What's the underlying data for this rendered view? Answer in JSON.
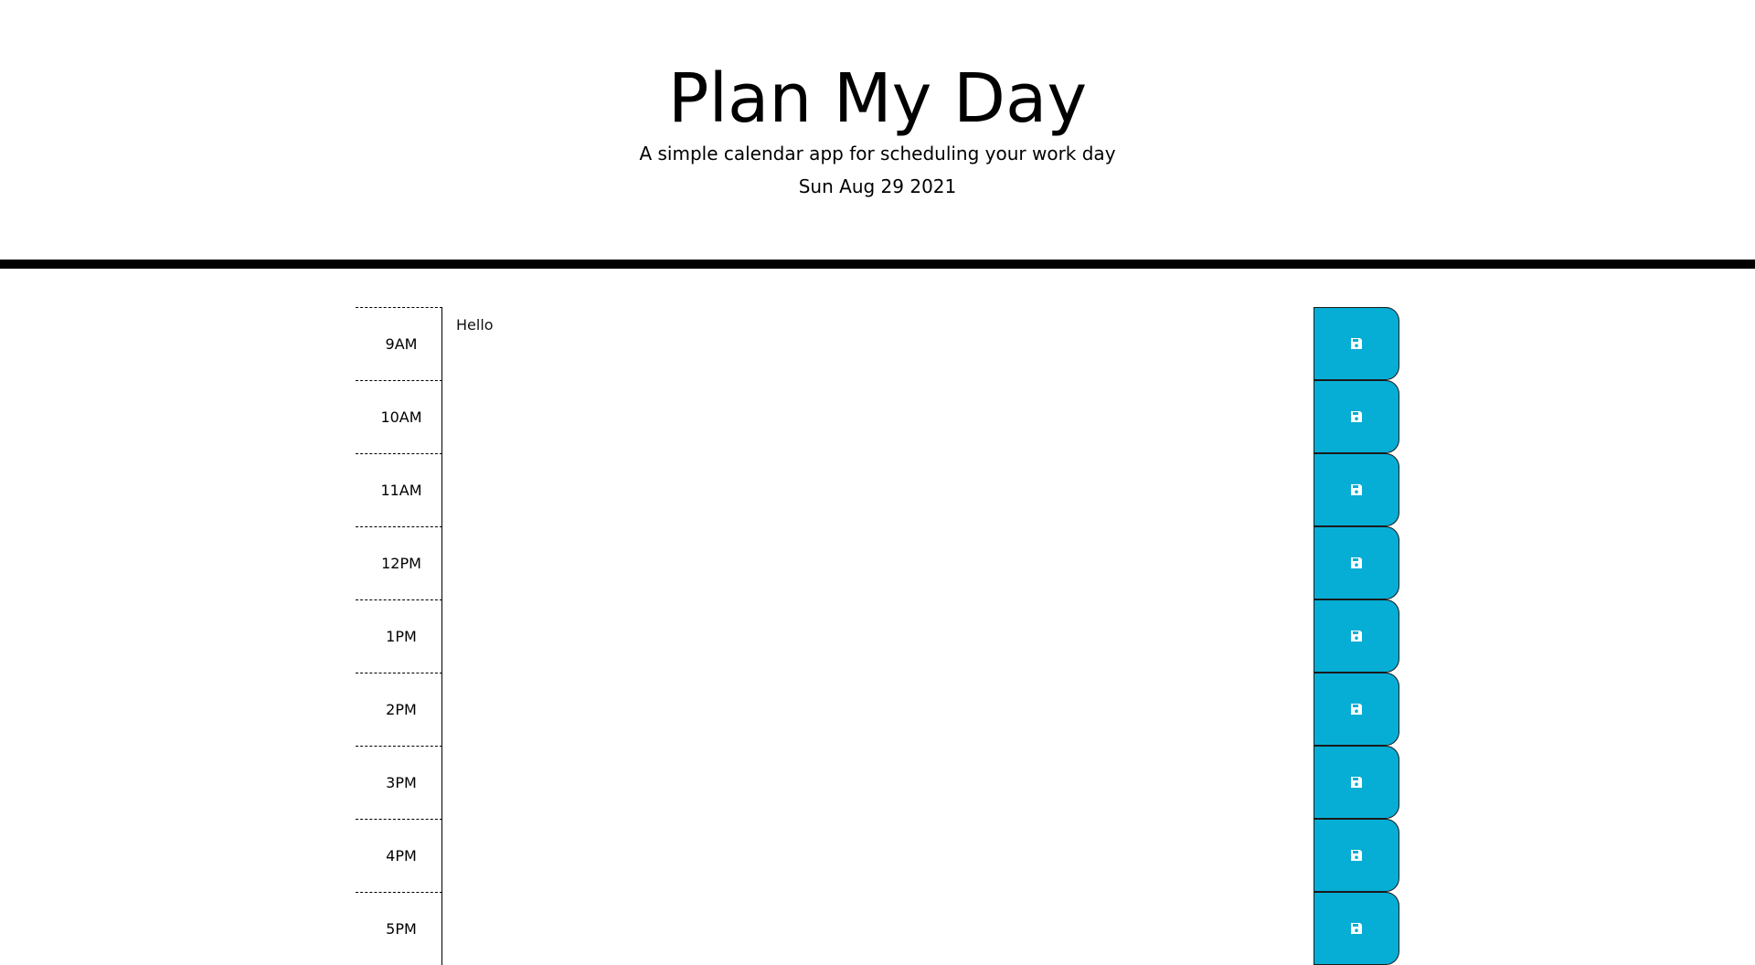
{
  "header": {
    "title": "Plan My Day",
    "subtitle": "A simple calendar app for scheduling your work day",
    "current_day": "Sun Aug 29 2021"
  },
  "colors": {
    "save_button": "#06aed5",
    "divider": "#000000"
  },
  "icons": {
    "save": "floppy-disk-icon"
  },
  "timeblocks": [
    {
      "hour": "9AM",
      "text": "Hello"
    },
    {
      "hour": "10AM",
      "text": ""
    },
    {
      "hour": "11AM",
      "text": ""
    },
    {
      "hour": "12PM",
      "text": ""
    },
    {
      "hour": "1PM",
      "text": ""
    },
    {
      "hour": "2PM",
      "text": ""
    },
    {
      "hour": "3PM",
      "text": ""
    },
    {
      "hour": "4PM",
      "text": ""
    },
    {
      "hour": "5PM",
      "text": ""
    }
  ]
}
